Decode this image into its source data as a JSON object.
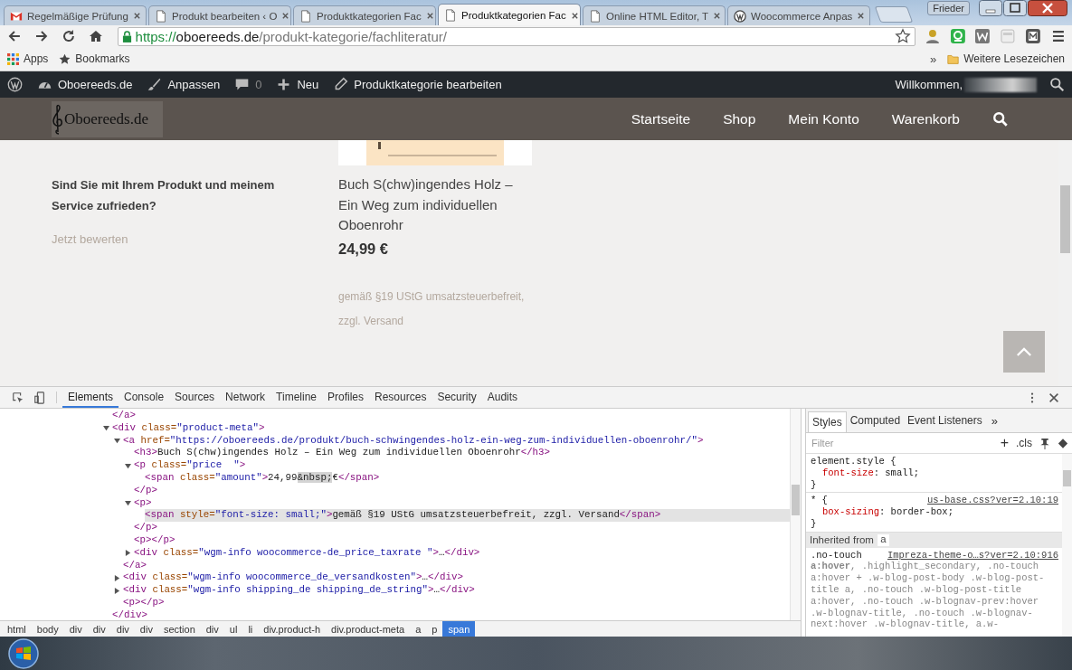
{
  "browser": {
    "tabs": [
      {
        "title": "Regelmäßige Prüfung",
        "kind": "mail",
        "selected": false
      },
      {
        "title": "Produkt bearbeiten ‹ O",
        "kind": "page",
        "selected": false
      },
      {
        "title": "Produktkategorien Fac",
        "kind": "page",
        "selected": false
      },
      {
        "title": "Produktkategorien Fac",
        "kind": "page",
        "selected": true
      },
      {
        "title": "Online HTML Editor, T",
        "kind": "page",
        "selected": false
      },
      {
        "title": "Woocommerce Anpas",
        "kind": "wordpress",
        "selected": false
      }
    ],
    "profile": "Frieder",
    "url": {
      "scheme": "https://",
      "host": "oboereeds.de",
      "path": "/produkt-kategorie/fachliteratur/"
    },
    "bookmarks": [
      {
        "label": "Apps",
        "kind": "apps"
      },
      {
        "label": "Bookmarks",
        "kind": "star"
      }
    ],
    "overflow": "»",
    "other_bookmarks": "Weitere Lesezeichen"
  },
  "admin_bar": {
    "site": "Oboereeds.de",
    "customize": "Anpassen",
    "comments": "0",
    "new": "Neu",
    "edit": "Produktkategorie bearbeiten",
    "greeting": "Willkommen,"
  },
  "site_header": {
    "logo": "Oboereeds.de",
    "nav": [
      "Startseite",
      "Shop",
      "Mein Konto",
      "Warenkorb"
    ]
  },
  "content": {
    "review_prompt": "Sind Sie mit Ihrem Produkt und meinem Service zufrieden?",
    "review_link": "Jetzt bewerten",
    "product": {
      "title": "Buch S(chw)ingendes Holz – Ein Weg zum individuellen Oboenrohr",
      "price": "24,99 €",
      "tax_note": "gemäß §19 UStG umsatzsteuerbefreit, zzgl. Versand"
    }
  },
  "devtools": {
    "tabs": [
      {
        "label": "Elements",
        "selected": true
      },
      {
        "label": "Console",
        "selected": false
      },
      {
        "label": "Sources",
        "selected": false
      },
      {
        "label": "Network",
        "selected": false
      },
      {
        "label": "Timeline",
        "selected": false
      },
      {
        "label": "Profiles",
        "selected": false
      },
      {
        "label": "Resources",
        "selected": false
      },
      {
        "label": "Security",
        "selected": false
      },
      {
        "label": "Audits",
        "selected": false
      }
    ],
    "dom_tree": [
      {
        "tag": "</a>",
        "selected": false
      },
      {
        "tag": "<div class=\"product-meta\">",
        "expanded": true,
        "selected": false,
        "children": [
          {
            "tag": "<a href=\"https://oboereeds.de/produkt/buch-schwingendes-holz-ein-weg-zum-individuellen-oboenrohr/\">",
            "expanded": true,
            "selected": false,
            "children": [
              {
                "tag": "<h3>Buch S(chw)ingendes Holz – Ein Weg zum individuellen Oboenrohr</h3>",
                "selected": false
              },
              {
                "tag": "<p class=\"price  \">",
                "expanded": true,
                "selected": false,
                "children": [
                  {
                    "tag": "<span class=\"amount\">24,99&nbsp;€</span>",
                    "selected": false
                  }
                ],
                "close": "</p>"
              },
              {
                "tag": "<p>",
                "expanded": true,
                "selected": false,
                "children": [
                  {
                    "tag": "<span style=\"font-size: small;\">gemäß §19 UStG umsatzsteuerbefreit, zzgl. Versand</span>",
                    "selected": true
                  }
                ],
                "close": "</p>"
              },
              {
                "tag": "<p></p>",
                "selected": false
              },
              {
                "tag": "<div class=\"wgm-info woocommerce-de_price_taxrate \">…</div>",
                "expanded": false,
                "selected": false
              }
            ],
            "close": "</a>"
          },
          {
            "tag": "<div class=\"wgm-info woocommerce_de_versandkosten\">…</div>",
            "expanded": false,
            "selected": false
          },
          {
            "tag": "<div class=\"wgm-info shipping_de shipping_de_string\">…</div>",
            "expanded": false,
            "selected": false
          },
          {
            "tag": "<p></p>",
            "selected": false
          }
        ],
        "close": "</div>"
      }
    ],
    "breadcrumbs": [
      {
        "label": "html",
        "selected": false
      },
      {
        "label": "body",
        "selected": false
      },
      {
        "label": "div",
        "selected": false
      },
      {
        "label": "div",
        "selected": false
      },
      {
        "label": "div",
        "selected": false
      },
      {
        "label": "div",
        "selected": false
      },
      {
        "label": "section",
        "selected": false
      },
      {
        "label": "div",
        "selected": false
      },
      {
        "label": "ul",
        "selected": false
      },
      {
        "label": "li",
        "selected": false
      },
      {
        "label": "div.product-h",
        "selected": false
      },
      {
        "label": "div.product-meta",
        "selected": false
      },
      {
        "label": "a",
        "selected": false
      },
      {
        "label": "p",
        "selected": false
      },
      {
        "label": "span",
        "selected": true
      }
    ],
    "styles": {
      "tabs": [
        {
          "label": "Styles",
          "selected": true
        },
        {
          "label": "Computed",
          "selected": false
        },
        {
          "label": "Event Listeners",
          "selected": false
        }
      ],
      "more": "»",
      "filter_placeholder": "Filter",
      "add_button": "+",
      "cls_button": ".cls",
      "rules": [
        {
          "selector": "element.style {",
          "declarations": [
            "font-size: small;"
          ],
          "close": "}"
        },
        {
          "selector": "* {",
          "source": "us-base.css?ver=2.10:19",
          "declarations": [
            "box-sizing: border-box;"
          ],
          "close": "}"
        }
      ],
      "inherited": {
        "label": "Inherited from",
        "element": "a",
        "selector_head": ".no-touch",
        "source": "Impreza-theme-o…s?ver=2.10:916",
        "selector_tail": "**a:hover**, .highlight_secondary, .no-touch a:hover + .w-blog-post-body .w-blog-post-title a, .no-touch .w-blog-post-title a:hover, .no-touch .w-blognav-prev:hover .w-blognav-title, .no-touch .w-blognav-next:hover .w-blognav-title, a.w-"
      }
    }
  }
}
